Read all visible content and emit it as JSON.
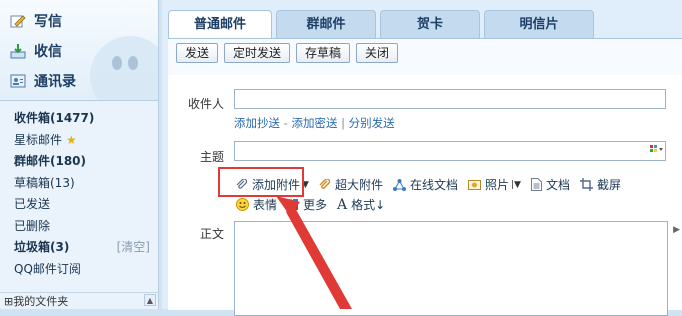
{
  "actions": {
    "compose": "写信",
    "inbox": "收信",
    "contacts": "通讯录"
  },
  "folders": [
    {
      "label": "收件箱(1477)",
      "bold": true
    },
    {
      "label": "星标邮件",
      "bold": false
    },
    {
      "label": "群邮件(180)",
      "bold": true
    },
    {
      "label": "草稿箱(13)",
      "bold": false
    },
    {
      "label": "已发送",
      "bold": false
    },
    {
      "label": "已删除",
      "bold": false
    },
    {
      "label": "垃圾箱(3)",
      "bold": true
    },
    {
      "label": "QQ邮件订阅",
      "bold": false
    }
  ],
  "trash_clear": "[清空]",
  "my_folders": "我的文件夹",
  "tabs": [
    "普通邮件",
    "群邮件",
    "贺卡",
    "明信片"
  ],
  "buttons": [
    "发送",
    "定时发送",
    "存草稿",
    "关闭"
  ],
  "form": {
    "recipient_label": "收件人",
    "recipient_value": "",
    "cc": "添加抄送",
    "bcc": "添加密送",
    "separate": "分别发送",
    "subject_label": "主题",
    "subject_value": "",
    "body_label": "正文"
  },
  "tools_row1": {
    "attach": "添加附件",
    "big_attach": "超大附件",
    "online_doc": "在线文档",
    "photo": "照片",
    "doc": "文档",
    "screenshot": "截屏"
  },
  "tools_row2": {
    "emoji": "表情",
    "more": "更多",
    "format": "格式↓"
  },
  "colors": {
    "accent": "#1d3f66",
    "link": "#2a6bb0",
    "highlight": "#e03a36"
  }
}
